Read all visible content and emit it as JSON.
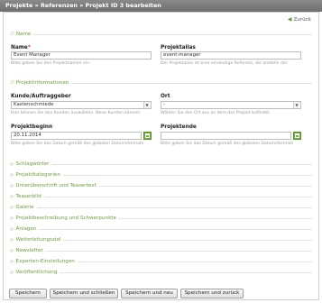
{
  "breadcrumb": "Projekte » Referenzen » Projekt ID 3 bearbeiten",
  "back_label": "Zurück",
  "sections": {
    "name": "Name",
    "projektinfo": "Projektinformationen"
  },
  "fields": {
    "name": {
      "label": "Name",
      "required": "*",
      "value": "Event Manager",
      "hint": "Bitte geben Sie den Projektnamen ein."
    },
    "alias": {
      "label": "Projektalias",
      "value": "event-manager",
      "hint": "Der Projektalias ist eine eindeutige Referenz, die anstelle der"
    },
    "kunde": {
      "label": "Kunde/Auftraggeber",
      "value": "Kastenschmiede",
      "hint": "Hier können Sie den Kunden auswählen. Neue Kunden können"
    },
    "ort": {
      "label": "Ort",
      "value": "-",
      "hint": "Wählen Sie den Ort aus an dem das Projekt befindet."
    },
    "beginn": {
      "label": "Projektbeginn",
      "value": "20.11.2014",
      "hint": "Bitte geben Sie das Datum gemäß des globalen Datumsformats"
    },
    "ende": {
      "label": "Projektende",
      "value": "",
      "hint": "Bitte geben Sie das Datum gemäß des globalen Datumsformats"
    }
  },
  "collapsed_sections": [
    "Schlagwörter",
    "Projektkategorien",
    "Unterüberschrift und Teasertext",
    "Teaserbild",
    "Galerie",
    "Projektbeschreibung und Schwerpunkte",
    "Anlagen",
    "Weiterleitungsziel",
    "Newsletter",
    "Experten-Einstellungen",
    "Veröffentlichung"
  ],
  "buttons": {
    "save": "Speichern",
    "save_close": "Speichern und schließen",
    "save_new": "Speichern und neu",
    "save_back": "Speichern und zurück"
  },
  "colors": {
    "accent": "#6a9e3a",
    "titlebar": "#7c7c7c",
    "calendar": "#6fb33a"
  }
}
